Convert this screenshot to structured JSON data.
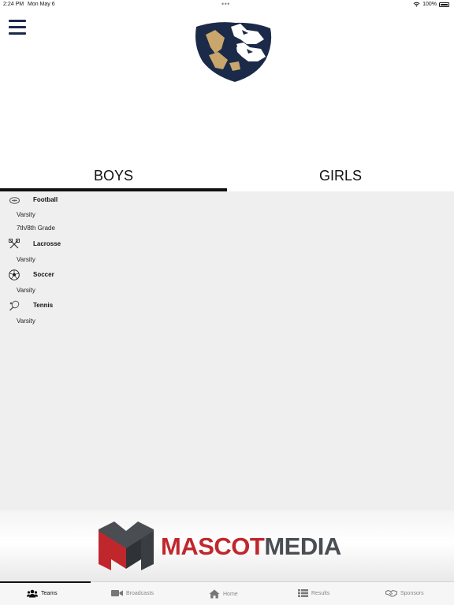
{
  "status_bar": {
    "time": "2:24 PM",
    "date": "Mon May 6",
    "dots": "•••",
    "battery": "100%"
  },
  "tabs": [
    {
      "label": "BOYS",
      "active": true
    },
    {
      "label": "GIRLS",
      "active": false
    }
  ],
  "sports": [
    {
      "name": "Football",
      "icon": "football-icon",
      "teams": [
        "Varsity",
        "7th/8th Grade"
      ]
    },
    {
      "name": "Lacrosse",
      "icon": "lacrosse-icon",
      "teams": [
        "Varsity"
      ]
    },
    {
      "name": "Soccer",
      "icon": "soccer-ball-icon",
      "teams": [
        "Varsity"
      ]
    },
    {
      "name": "Tennis",
      "icon": "tennis-racket-icon",
      "teams": [
        "Varsity"
      ]
    }
  ],
  "sponsor": {
    "word1": "MASCOT",
    "word2": "MEDIA",
    "colors": {
      "red": "#c0272d",
      "gray": "#4a4d52"
    }
  },
  "bottom_nav": [
    {
      "label": "Teams",
      "icon": "teams-icon",
      "active": true
    },
    {
      "label": "Broadcasts",
      "icon": "video-camera-icon",
      "active": false
    },
    {
      "label": "Home",
      "icon": "home-icon",
      "active": false
    },
    {
      "label": "Results",
      "icon": "list-icon",
      "active": false
    },
    {
      "label": "Sponsors",
      "icon": "handshake-icon",
      "active": false
    }
  ],
  "colors": {
    "brand_navy": "#1b2a48",
    "brand_gold": "#c9a66b",
    "content_bg": "#efefef"
  }
}
